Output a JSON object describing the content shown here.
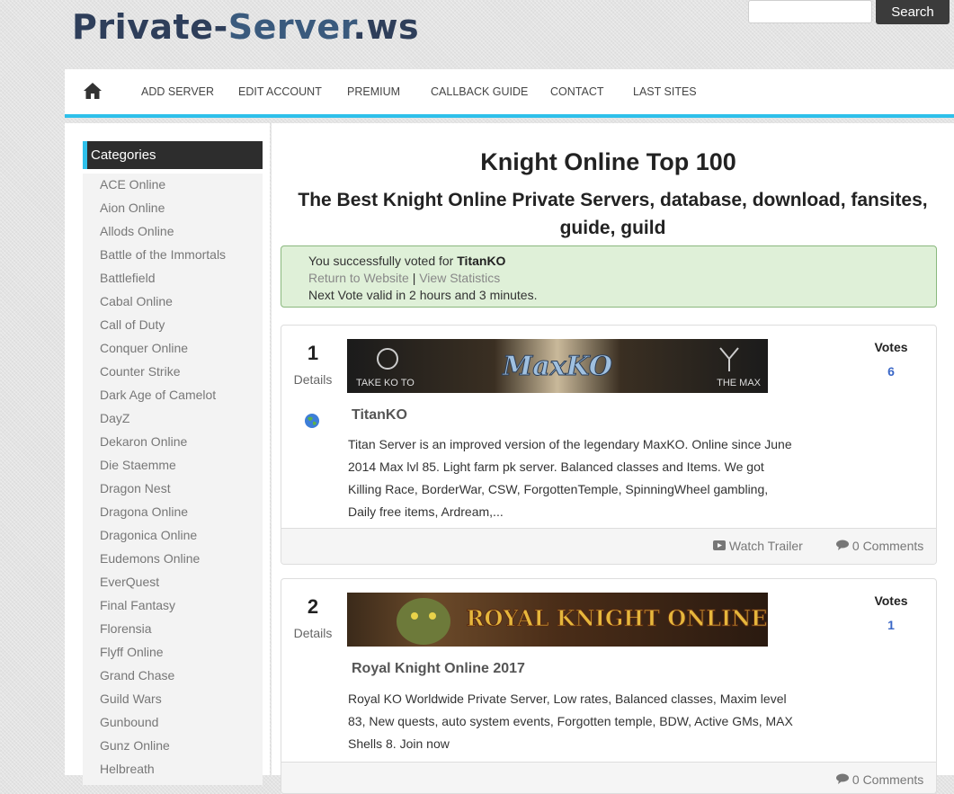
{
  "logo": {
    "part1": "Private-",
    "part2": "Server",
    "part3": ".ws"
  },
  "search": {
    "placeholder": "",
    "button_label": "Search"
  },
  "nav": {
    "items": [
      "ADD SERVER",
      "EDIT ACCOUNT",
      "PREMIUM",
      "CALLBACK GUIDE",
      "CONTACT",
      "LAST SITES"
    ]
  },
  "sidebar": {
    "title": "Categories",
    "items": [
      "ACE Online",
      "Aion Online",
      "Allods Online",
      "Battle of the Immortals",
      "Battlefield",
      "Cabal Online",
      "Call of Duty",
      "Conquer Online",
      "Counter Strike",
      "Dark Age of Camelot",
      "DayZ",
      "Dekaron Online",
      "Die Staemme",
      "Dragon Nest",
      "Dragona Online",
      "Dragonica Online",
      "Eudemons Online",
      "EverQuest",
      "Final Fantasy",
      "Florensia",
      "Flyff Online",
      "Grand Chase",
      "Guild Wars",
      "Gunbound",
      "Gunz Online",
      "Helbreath"
    ]
  },
  "main": {
    "title": "Knight Online Top 100",
    "subtitle": "The Best Knight Online Private Servers, database, download, fansites, guide, guild"
  },
  "alert": {
    "voted_prefix": "You successfully voted for",
    "server": "TitanKO",
    "return_link": "Return to Website",
    "separator": "|",
    "stats_link": "View Statistics",
    "next_vote": "Next Vote valid in 2 hours and 3 minutes."
  },
  "servers": [
    {
      "rank": "1",
      "details": "Details",
      "votes_label": "Votes",
      "votes": "6",
      "name": "TitanKO",
      "banner": {
        "left": "TAKE KO TO",
        "center": "MaxKO",
        "right": "THE MAX"
      },
      "description": "Titan Server is an improved version of the legendary MaxKO. Online since June 2014 Max lvl 85. Light farm pk server. Balanced classes and Items. We got Killing Race, BorderWar, CSW, ForgottenTemple, SpinningWheel gambling, Daily free items, Ardream,...",
      "trailer": "Watch Trailer",
      "comments": "0 Comments"
    },
    {
      "rank": "2",
      "details": "Details",
      "votes_label": "Votes",
      "votes": "1",
      "name": "Royal Knight Online 2017",
      "banner": {
        "center": "ROYAL KNIGHT ONLINE"
      },
      "description": "Royal KO Worldwide Private Server, Low rates, Balanced classes, Maxim level 83, New quests, auto system events, Forgotten temple, BDW, Active GMs, MAX Shells 8. Join now",
      "comments": "0 Comments"
    }
  ],
  "colors": {
    "accent": "#2ec0ea",
    "votes": "#3a67c7",
    "alert_bg": "#dff0d8",
    "dark": "#2d2d2d"
  }
}
